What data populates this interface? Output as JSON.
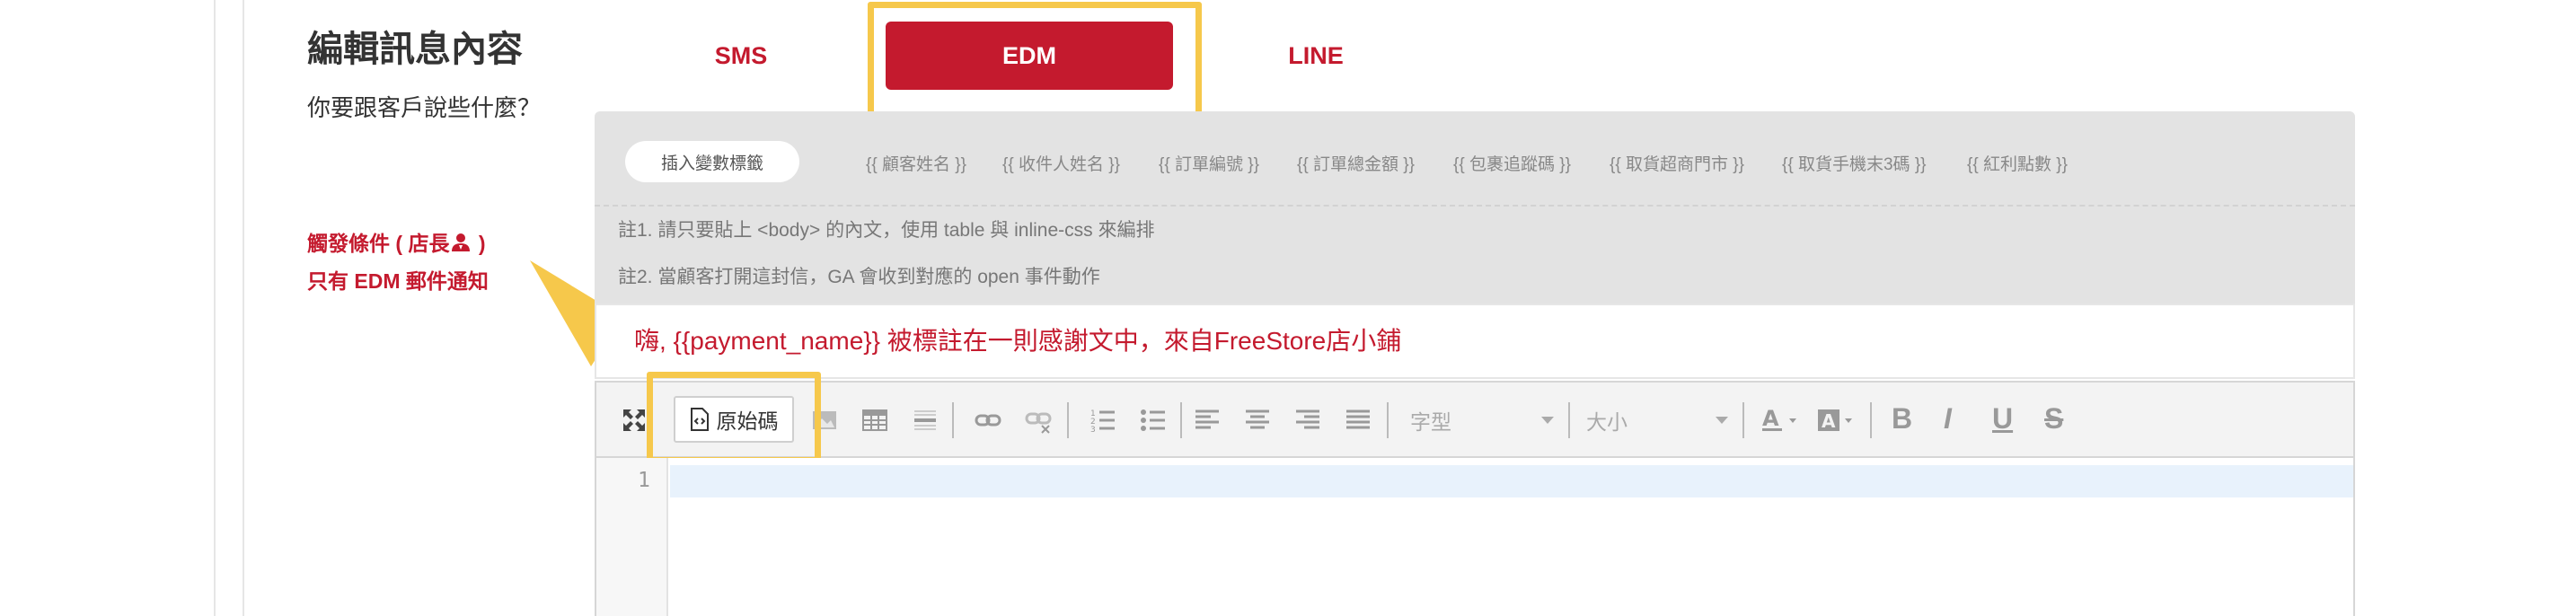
{
  "section": {
    "title": "編輯訊息內容",
    "subtitle": "你要跟客戶說些什麼？",
    "trigger_line1_prefix": "觸發條件 ( 店長",
    "trigger_line1_suffix": " )",
    "trigger_line2": "只有 EDM 郵件通知"
  },
  "tabs": [
    {
      "label": "SMS"
    },
    {
      "label": "EDM",
      "active": true
    },
    {
      "label": "LINE"
    }
  ],
  "variables": {
    "insert_label": "插入變數標籤",
    "tags": [
      "{{ 顧客姓名 }}",
      "{{ 收件人姓名 }}",
      "{{ 訂單編號 }}",
      "{{ 訂單總金額 }}",
      "{{ 包裹追蹤碼 }}",
      "{{ 取貨超商門市 }}",
      "{{ 取貨手機末3碼 }}",
      "{{ 紅利點數 }}"
    ]
  },
  "notes": [
    "註1. 請只要貼上 <body> 的內文，使用 table 與 inline-css 來編排",
    "註2. 當顧客打開這封信，GA 會收到對應的 open 事件動作"
  ],
  "subject": "嗨, {{payment_name}} 被標註在一則感謝文中，來自FreeStore店小鋪",
  "toolbar": {
    "source_label": "原始碼",
    "font_placeholder": "字型",
    "size_placeholder": "大小",
    "icons": [
      "maximize-icon",
      "source-icon",
      "image-icon",
      "table-icon",
      "horizontal-rule-icon",
      "link-icon",
      "unlink-icon",
      "numbered-list-icon",
      "bulleted-list-icon",
      "align-left-icon",
      "align-center-icon",
      "align-right-icon",
      "justify-icon",
      "text-color-icon",
      "background-color-icon",
      "bold-icon",
      "italic-icon",
      "underline-icon",
      "strikethrough-icon"
    ]
  },
  "editor": {
    "line_number": "1"
  },
  "colors": {
    "accent": "#c41a2e",
    "highlight": "#f6c84b",
    "panel": "#e3e3e3"
  }
}
